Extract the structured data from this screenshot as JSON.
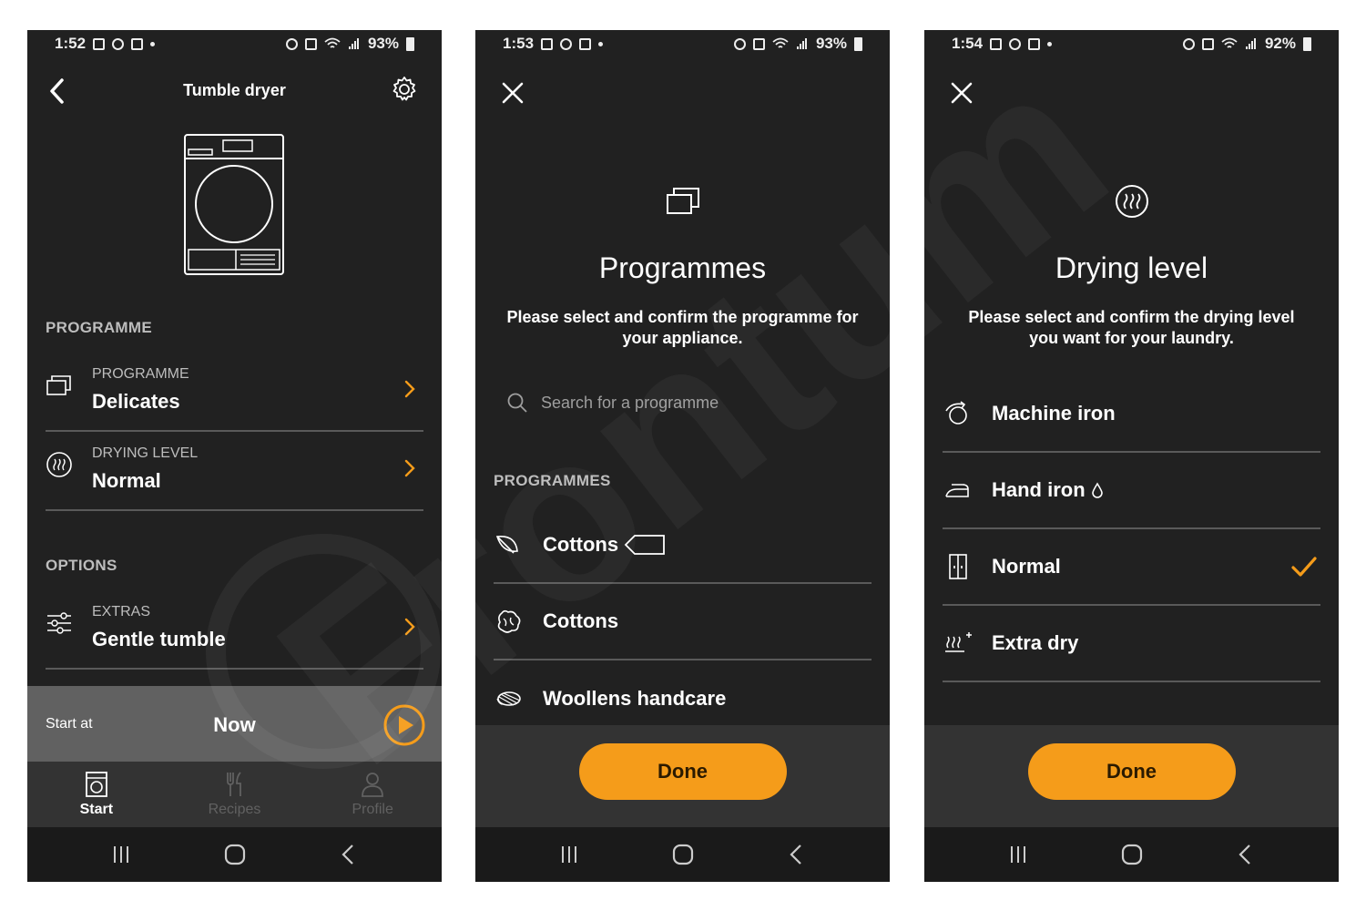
{
  "colors": {
    "accent": "#f59c1a",
    "background": "#212121",
    "divider": "#5a5a5a"
  },
  "screen1": {
    "status": {
      "time": "1:52",
      "battery": "93%"
    },
    "title": "Tumble dryer",
    "section_programme": "PROGRAMME",
    "programme_row": {
      "label": "PROGRAMME",
      "value": "Delicates"
    },
    "drying_row": {
      "label": "DRYING LEVEL",
      "value": "Normal"
    },
    "section_options": "OPTIONS",
    "extras_row": {
      "label": "EXTRAS",
      "value": "Gentle tumble"
    },
    "start": {
      "label": "Start at",
      "value": "Now"
    },
    "tabs": [
      {
        "label": "Start",
        "icon": "washer-icon",
        "active": true
      },
      {
        "label": "Recipes",
        "icon": "cutlery-icon",
        "active": false
      },
      {
        "label": "Profile",
        "icon": "person-icon",
        "active": false
      }
    ]
  },
  "screen2": {
    "status": {
      "time": "1:53",
      "battery": "93%"
    },
    "title": "Programmes",
    "description": "Please select and confirm the programme for your appliance.",
    "search_placeholder": "Search for a programme",
    "section": "PROGRAMMES",
    "items": [
      {
        "label": "Cottons",
        "icon": "leaf-icon"
      },
      {
        "label": "Cottons",
        "icon": "cotton-flower-icon"
      },
      {
        "label": "Woollens handcare",
        "icon": "wool-icon"
      }
    ],
    "done_label": "Done"
  },
  "screen3": {
    "status": {
      "time": "1:54",
      "battery": "92%"
    },
    "title": "Drying level",
    "description": "Please select and confirm the drying level you want for your laundry.",
    "items": [
      {
        "label": "Machine iron",
        "icon": "machine-iron-icon",
        "selected": false
      },
      {
        "label": "Hand iron",
        "icon": "hand-iron-icon",
        "selected": false
      },
      {
        "label": "Normal",
        "icon": "wardrobe-icon",
        "selected": true
      },
      {
        "label": "Extra dry",
        "icon": "extra-dry-icon",
        "selected": false
      }
    ],
    "done_label": "Done"
  },
  "watermark": "Frontum"
}
